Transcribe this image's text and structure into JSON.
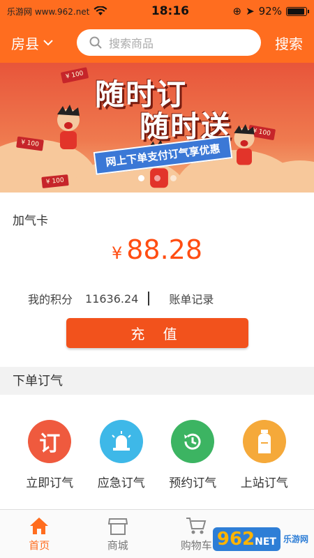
{
  "status": {
    "carrier": "乐游网 www.962.net",
    "time": "18:16",
    "battery_text": "92%",
    "battery_level": 0.92
  },
  "header": {
    "city": "房县",
    "search_placeholder": "搜索商品",
    "search_button": "搜索"
  },
  "banner": {
    "headline_1": "随时订",
    "headline_2": "随时送",
    "ribbon": "网上下单支付订气享优惠",
    "cash_label": "¥ 100",
    "pages": 3,
    "active_page": 1
  },
  "gas_card": {
    "title": "加气卡",
    "currency": "¥",
    "balance": "88.28",
    "points_label": "我的积分",
    "points_value": "11636.24",
    "bill_link": "账单记录",
    "recharge_button": "充 值"
  },
  "order_section": {
    "title": "下单订气",
    "items": [
      {
        "label": "立即订气",
        "icon": "order-now-icon",
        "color": "#ef5a3e"
      },
      {
        "label": "应急订气",
        "icon": "emergency-siren-icon",
        "color": "#3eb8e8"
      },
      {
        "label": "预约订气",
        "icon": "schedule-clock-icon",
        "color": "#3cb462"
      },
      {
        "label": "上站订气",
        "icon": "gas-cylinder-icon",
        "color": "#f5a93a"
      }
    ]
  },
  "tabbar": {
    "tabs": [
      {
        "label": "首页",
        "icon": "home-icon",
        "active": true
      },
      {
        "label": "商城",
        "icon": "store-icon",
        "active": false
      },
      {
        "label": "购物车",
        "icon": "cart-icon",
        "active": false
      }
    ]
  },
  "watermark": {
    "logo": "962",
    "logo_suffix": "NET",
    "text": "乐游网"
  },
  "colors": {
    "brand": "#ff6d1f",
    "price": "#ff4d12",
    "button": "#f2521c"
  }
}
